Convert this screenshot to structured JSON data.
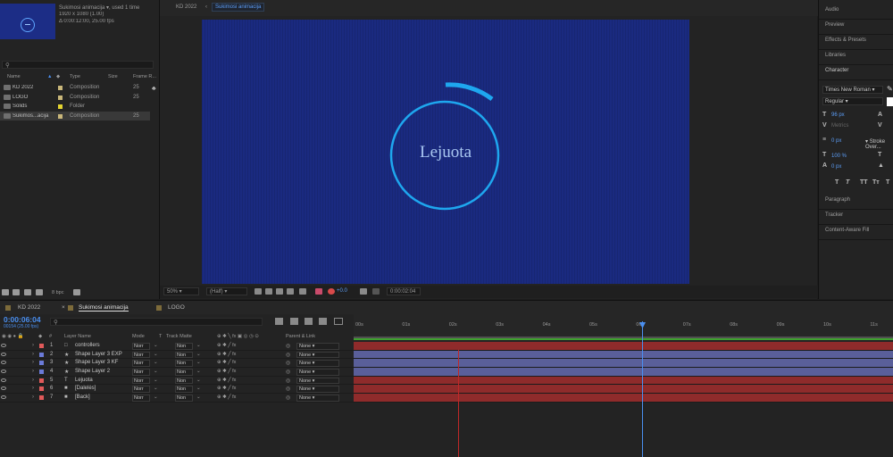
{
  "project": {
    "comp_name": "Sukimosi animacija ▾",
    "used": ", used 1 time",
    "resolution": "1920 x 1080 (1.00)",
    "duration": "Δ 0:00:12:00, 25.00 fps",
    "columns": {
      "name": "Name",
      "type": "Type",
      "size": "Size",
      "frame_rate": "Frame R..."
    },
    "items": [
      {
        "name": "KD 2022",
        "type": "Composition",
        "fr": "25",
        "color": "#c9b77a"
      },
      {
        "name": "LOGO",
        "type": "Composition",
        "fr": "25",
        "color": "#c9b77a"
      },
      {
        "name": "Solids",
        "type": "Folder",
        "fr": "",
        "color": "#e4d430"
      },
      {
        "name": "Sukimos...acija",
        "type": "Composition",
        "fr": "25",
        "color": "#c9b77a"
      }
    ],
    "bpc": "8 bpc"
  },
  "viewer": {
    "tabs": [
      "KD 2022",
      "Sukimosi animacija"
    ],
    "comp_text": "Lejuota",
    "zoom": "50%",
    "resolution": "(Half)",
    "exposure": "+0.0",
    "timecode": "0:00:02:04"
  },
  "right_panel": {
    "sections": [
      "Audio",
      "Preview",
      "Effects & Presets",
      "Libraries",
      "Character",
      "Paragraph",
      "Tracker",
      "Content-Aware Fill"
    ],
    "font": "Times New Roman",
    "style": "Regular",
    "font_size": "96 px",
    "metrics": "Metrics",
    "stroke_px": "0 px",
    "stroke_mode": "Stroke Over...",
    "vscale": "100 %",
    "baseline": "0 px",
    "type_buttons": [
      "T",
      "T",
      "TT",
      "Tт",
      "T",
      "T"
    ]
  },
  "timeline": {
    "tabs": [
      "KD 2022",
      "Sukimosi animacija",
      "LOGO"
    ],
    "timecode": "0:00:06:04",
    "fps": "00154 (25.00 fps)",
    "columns": {
      "layer_name": "Layer Name",
      "mode": "Mode",
      "t": "T",
      "track_matte": "Track Matte",
      "parent": "Parent & Link"
    },
    "ruler": [
      "00s",
      "01s",
      "02s",
      "03s",
      "04s",
      "05s",
      "06s",
      "07s",
      "08s",
      "09s",
      "10s",
      "11s"
    ],
    "layers": [
      {
        "num": "1",
        "name": "controllers",
        "icon": "□",
        "color": "#e05a5a",
        "mode": "Norr",
        "matte": "Non",
        "parent": "None",
        "bar": "#8f2b2b"
      },
      {
        "num": "2",
        "name": "Shape Layer 3 EXP",
        "icon": "★",
        "color": "#6b7bd9",
        "mode": "Norr",
        "matte": "Non",
        "parent": "None",
        "bar": "#5a5f9a"
      },
      {
        "num": "3",
        "name": "Shape Layer 3 KF",
        "icon": "★",
        "color": "#6b7bd9",
        "mode": "Norr",
        "matte": "Non",
        "parent": "None",
        "bar": "#5a5f9a"
      },
      {
        "num": "4",
        "name": "Shape Layer 2",
        "icon": "★",
        "color": "#6b7bd9",
        "mode": "Norr",
        "matte": "Non",
        "parent": "None",
        "bar": "#5a5f9a"
      },
      {
        "num": "5",
        "name": "Lejuota",
        "icon": "T",
        "color": "#e05a5a",
        "mode": "Norr",
        "matte": "Non",
        "parent": "None",
        "bar": "#8f2b2b"
      },
      {
        "num": "6",
        "name": "[Dalelės]",
        "icon": "■",
        "color": "#e05a5a",
        "mode": "Norr",
        "matte": "Non",
        "parent": "None",
        "bar": "#8f2b2b"
      },
      {
        "num": "7",
        "name": "[Back]",
        "icon": "■",
        "color": "#e05a5a",
        "mode": "Norr",
        "matte": "Non",
        "parent": "None",
        "bar": "#8f2b2b"
      }
    ]
  }
}
